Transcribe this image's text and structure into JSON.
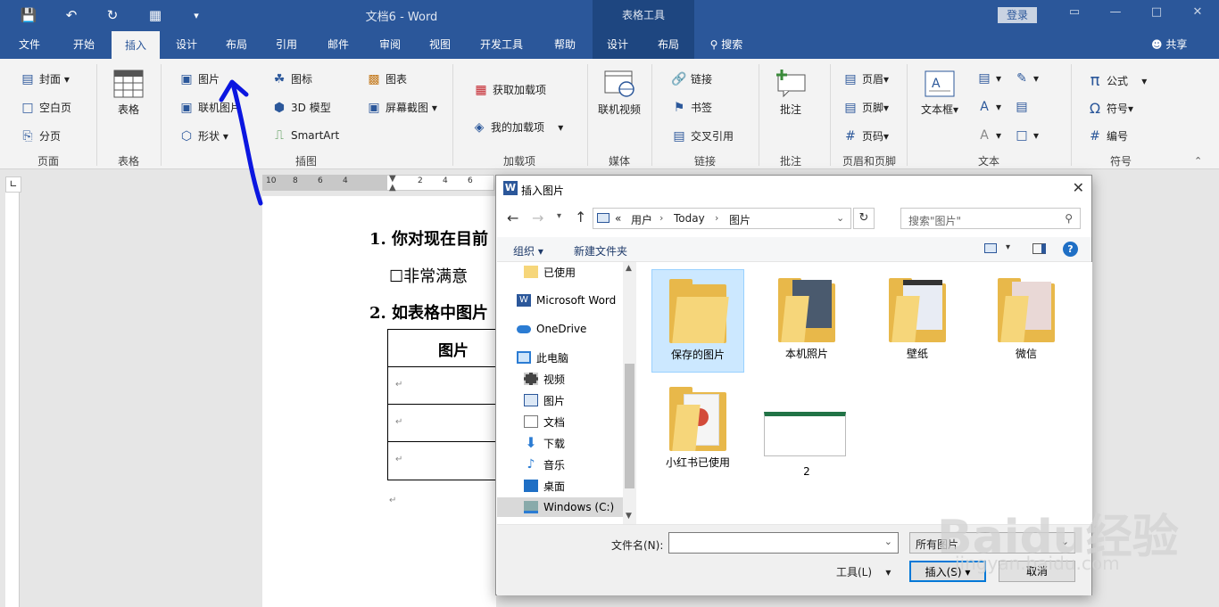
{
  "titlebar": {
    "doc_title": "文档6 - Word",
    "context_title": "表格工具",
    "login": "登录"
  },
  "tabs": [
    "文件",
    "开始",
    "插入",
    "设计",
    "布局",
    "引用",
    "邮件",
    "审阅",
    "视图",
    "开发工具",
    "帮助",
    "设计",
    "布局",
    "搜索"
  ],
  "share": "共享",
  "ribbon": {
    "pages": {
      "cover": "封面",
      "blank": "空白页",
      "break": "分页",
      "group": "页面"
    },
    "tables": {
      "table": "表格",
      "group": "表格"
    },
    "illustrations": {
      "pictures": "图片",
      "online": "联机图片",
      "shapes": "形状",
      "icons": "图标",
      "models": "3D 模型",
      "smartart": "SmartArt",
      "chart": "图表",
      "screenshot": "屏幕截图",
      "group": "插图"
    },
    "addins": {
      "get": "获取加载项",
      "my": "我的加载项",
      "group": "加载项"
    },
    "media": {
      "video": "联机视频",
      "group": "媒体"
    },
    "links": {
      "link": "链接",
      "bookmark": "书签",
      "crossref": "交叉引用",
      "group": "链接"
    },
    "comments": {
      "comment": "批注",
      "group": "批注"
    },
    "headerfooter": {
      "header": "页眉",
      "footer": "页脚",
      "pagenum": "页码",
      "group": "页眉和页脚"
    },
    "text": {
      "textbox": "文本框",
      "group": "文本"
    },
    "symbols": {
      "equation": "公式",
      "symbol": "符号",
      "number": "编号",
      "group": "符号"
    }
  },
  "ruler": [
    "10",
    "8",
    "6",
    "4",
    "2",
    "4",
    "6"
  ],
  "document": {
    "q1": "1. 你对现在目前",
    "option1": "☐非常满意",
    "q2": "2. 如表格中图片",
    "table_header": "图片"
  },
  "dialog": {
    "title": "插入图片",
    "path": [
      "«",
      "用户",
      "Today",
      "图片"
    ],
    "search_placeholder": "搜索\"图片\"",
    "organize": "组织",
    "new_folder": "新建文件夹",
    "nav": [
      "已使用",
      "Microsoft Word",
      "OneDrive",
      "此电脑",
      "视频",
      "图片",
      "文档",
      "下载",
      "音乐",
      "桌面",
      "Windows (C:)"
    ],
    "files": [
      "保存的图片",
      "本机照片",
      "壁纸",
      "微信",
      "小红书已使用",
      "2"
    ],
    "filename_label": "文件名(N):",
    "filename_value": "",
    "filter": "所有图片",
    "tools": "工具(L)",
    "insert": "插入(S)",
    "cancel": "取消"
  },
  "watermark": {
    "brand": "Baidu经验",
    "url": "jingyan.baidu.com"
  },
  "colors": {
    "accent": "#2b579a",
    "context": "#1e4680",
    "selection": "#cce8ff",
    "annotation": "#0b16e0"
  }
}
